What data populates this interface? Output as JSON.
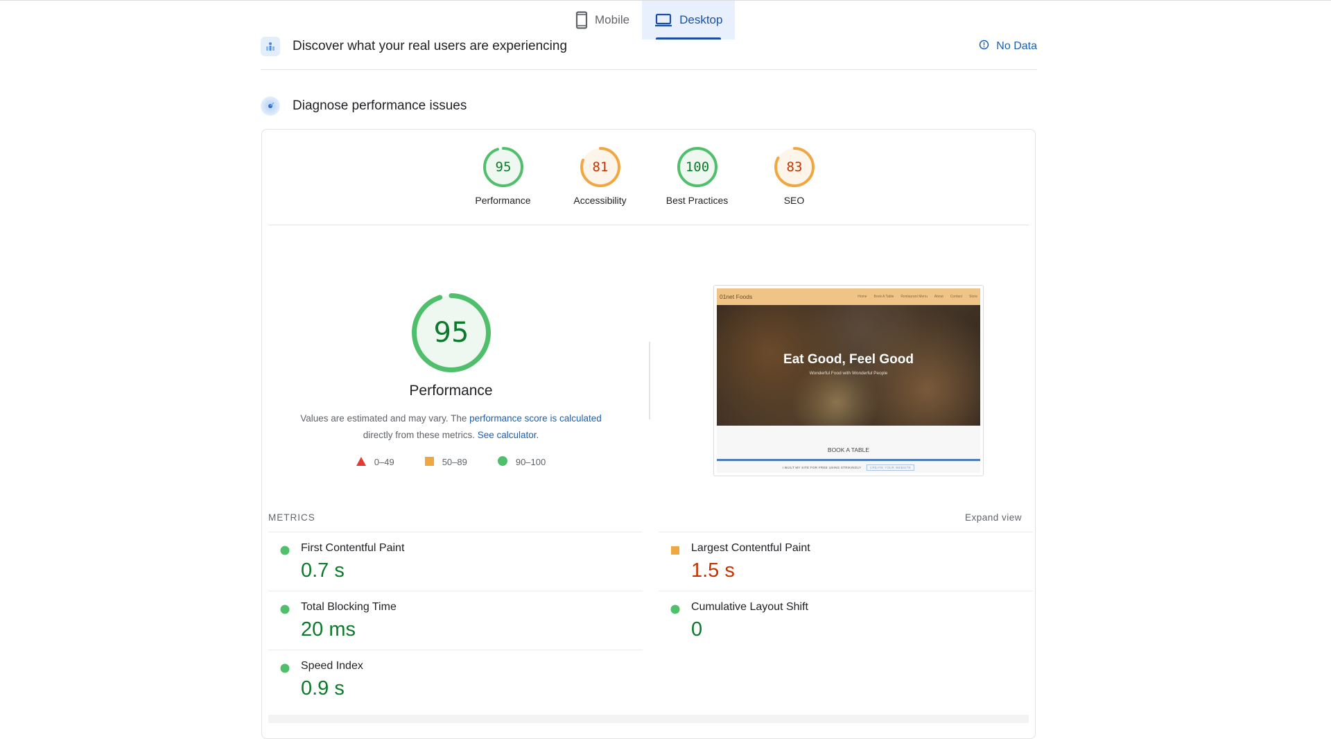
{
  "device_tabs": [
    {
      "label": "Mobile",
      "icon": "phone-icon",
      "active": false
    },
    {
      "label": "Desktop",
      "icon": "laptop-icon",
      "active": true
    }
  ],
  "crux_section": {
    "title": "Discover what your real users are experiencing",
    "status_icon": "info-icon",
    "status_text": "No Data"
  },
  "diagnose_section": {
    "title": "Diagnose performance issues"
  },
  "colors": {
    "pass": "#0c7a2a",
    "pass_ring": "#4fbf6b",
    "pass_fill": "#eef8f0",
    "average": "#c33300",
    "average_ring": "#f0a742",
    "average_fill": "#fdf4ea",
    "fail": "#e53935",
    "link": "#1a5fb4",
    "active_tab": "#1a4ea3"
  },
  "categories": [
    {
      "label": "Performance",
      "score": 95,
      "rating": "pass"
    },
    {
      "label": "Accessibility",
      "score": 81,
      "rating": "average"
    },
    {
      "label": "Best Practices",
      "score": 100,
      "rating": "pass"
    },
    {
      "label": "SEO",
      "score": 83,
      "rating": "average"
    }
  ],
  "performance": {
    "score": 95,
    "title": "Performance",
    "desc_prefix": "Values are estimated and may vary. The ",
    "desc_link1": "performance score is calculated",
    "desc_mid": " directly from these metrics. ",
    "desc_link2": "See calculator.",
    "legend": [
      {
        "shape": "triangle",
        "range": "0–49"
      },
      {
        "shape": "square",
        "range": "50–89"
      },
      {
        "shape": "circle",
        "range": "90–100"
      }
    ]
  },
  "screenshot": {
    "site_name": "01net Foods",
    "nav_links": [
      "Home",
      "Book A Table",
      "Restaurant Menu",
      "About",
      "Contact",
      "Store"
    ],
    "hero_title": "Eat Good, Feel Good",
    "hero_subtitle": "Wonderful Food with Wonderful People",
    "section_heading": "BOOK A TABLE",
    "footer_text": "I BUILT MY SITE FOR FREE USING STRIKINGLY",
    "footer_cta": "CREATE YOUR WEBSITE"
  },
  "metrics": {
    "heading": "METRICS",
    "expand_label": "Expand view",
    "left": [
      {
        "name": "First Contentful Paint",
        "value": "0.7 s",
        "rating": "pass"
      },
      {
        "name": "Total Blocking Time",
        "value": "20 ms",
        "rating": "pass"
      },
      {
        "name": "Speed Index",
        "value": "0.9 s",
        "rating": "pass"
      }
    ],
    "right": [
      {
        "name": "Largest Contentful Paint",
        "value": "1.5 s",
        "rating": "average"
      },
      {
        "name": "Cumulative Layout Shift",
        "value": "0",
        "rating": "pass"
      }
    ]
  }
}
